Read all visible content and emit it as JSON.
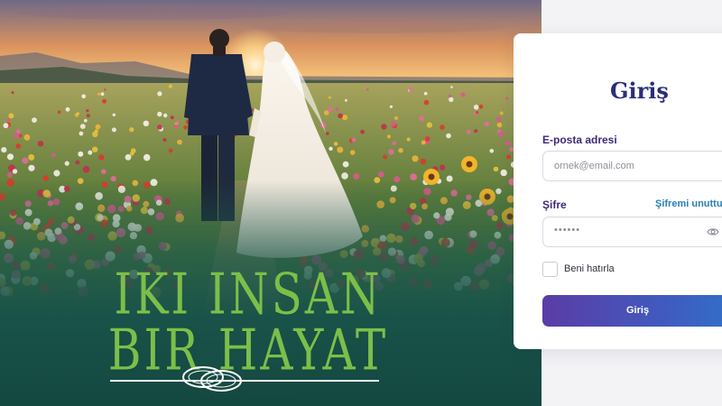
{
  "hero": {
    "title_line1": "IKI INSAN",
    "title_line2": "BIR HAYAT"
  },
  "login": {
    "title": "Giriş",
    "email_label": "E-posta adresi",
    "email_placeholder": "ornek@email.com",
    "password_label": "Şifre",
    "forgot_link": "Şifremi unuttun",
    "password_value": "••••••",
    "remember_label": "Beni hatırla",
    "remember_checked": false,
    "submit_label": "Giriş"
  },
  "colors": {
    "title_green": "#7bbf4a",
    "card_title": "#2a2d7c",
    "label": "#3d2a78",
    "link": "#2a7fb7",
    "button_start": "#5b3ca6",
    "button_end": "#2f72c8"
  },
  "icons": {
    "password_toggle": "eye-icon",
    "hero_emblem": "wedding-rings-icon"
  }
}
